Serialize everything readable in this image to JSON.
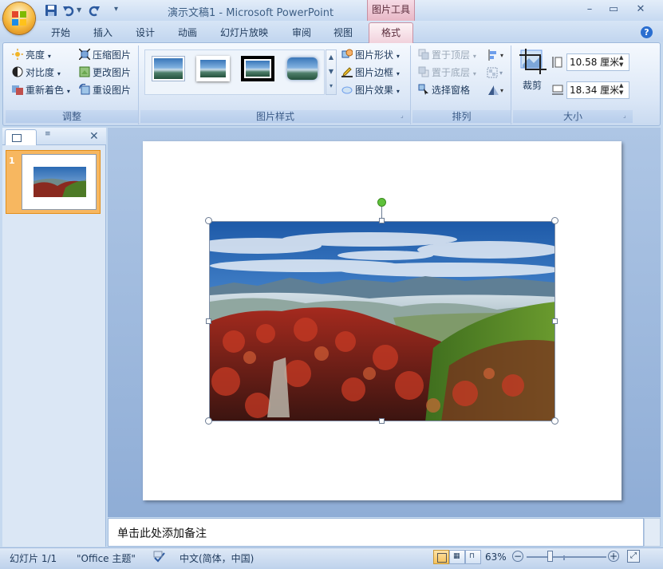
{
  "title": {
    "document": "演示文稿1",
    "separator": " - ",
    "app": "Microsoft PowerPoint",
    "context_tool": "图片工具"
  },
  "tabs": [
    "开始",
    "插入",
    "设计",
    "动画",
    "幻灯片放映",
    "审阅",
    "视图"
  ],
  "active_tab": "格式",
  "ribbon": {
    "adjust": {
      "label": "调整",
      "brightness": "亮度",
      "contrast": "对比度",
      "recolor": "重新着色",
      "compress": "压缩图片",
      "change": "更改图片",
      "reset": "重设图片"
    },
    "styles": {
      "label": "图片样式",
      "shape": "图片形状",
      "border": "图片边框",
      "effects": "图片效果"
    },
    "arrange": {
      "label": "排列",
      "bring_front": "置于顶层",
      "send_back": "置于底层",
      "selection_pane": "选择窗格"
    },
    "size": {
      "label": "大小",
      "crop": "裁剪",
      "height": "10.58 厘米",
      "width": "18.34 厘米"
    }
  },
  "slide_panel": {
    "slide_number": "1"
  },
  "notes": {
    "placeholder": "单击此处添加备注"
  },
  "status": {
    "slide": "幻灯片 1/1",
    "theme": "\"Office 主题\"",
    "language": "中文(简体，中国)",
    "zoom": "63%"
  },
  "colors": {
    "ribbon_blue": "#dae6f6",
    "context_pink": "#e8b7c6",
    "selection_orange": "#f7b760",
    "rotate_handle": "#5fc13b"
  }
}
